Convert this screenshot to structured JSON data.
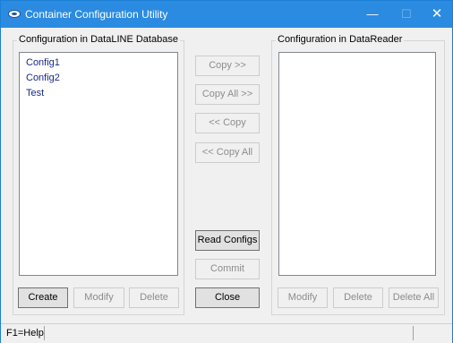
{
  "window": {
    "title": "Container Configuration Utility",
    "minimize": "—",
    "maximize": "☐",
    "close": "✕"
  },
  "left_group": {
    "label": "Configuration in DataLINE Database",
    "items": [
      "Config1",
      "Config2",
      "Test"
    ],
    "create_label": "Create",
    "modify_label": "Modify",
    "delete_label": "Delete"
  },
  "right_group": {
    "label": "Configuration in DataReader",
    "items": [],
    "modify_label": "Modify",
    "delete_label": "Delete",
    "delete_all_label": "Delete All"
  },
  "middle": {
    "copy_right_label": "Copy >>",
    "copy_all_right_label": "Copy All >>",
    "copy_left_label": "<< Copy",
    "copy_all_left_label": "<< Copy All",
    "read_configs_label": "Read Configs",
    "commit_label": "Commit",
    "close_label": "Close"
  },
  "statusbar": {
    "help_text": "F1=Help"
  }
}
